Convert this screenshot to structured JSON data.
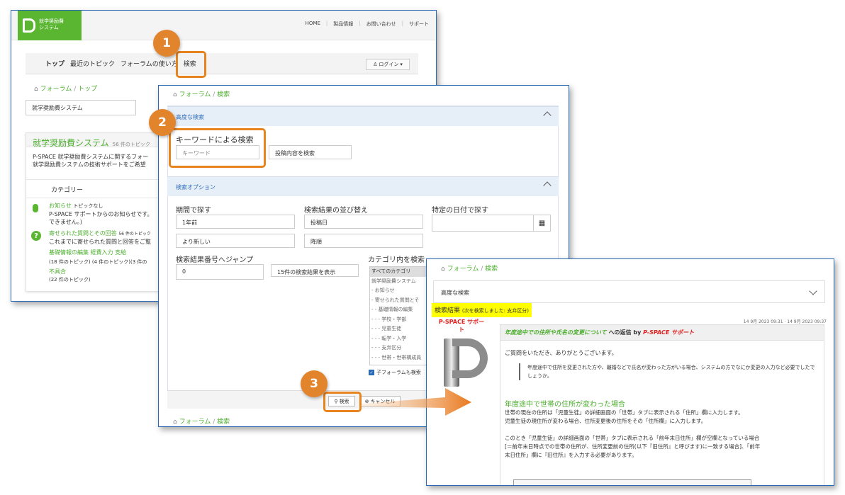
{
  "win1": {
    "logo_text": "就学奨励費\nシステム",
    "topnav": [
      "HOME",
      "製品情報",
      "お問い合わせ",
      "サポート"
    ],
    "menu": [
      "トップ",
      "最近のトピック",
      "フォーラムの使い方",
      "検索"
    ],
    "login": "ログイン",
    "breadcrumb": [
      "フォーラム",
      "トップ"
    ],
    "forum_select": "就学奨励費システム",
    "forum_title": "就学奨励費システム",
    "forum_topics": "56 件のトピック",
    "desc": "P-SPACE 就学奨励費システムに関するフォー\n就学奨励費システムの技術サポートをご希望",
    "category_header": "カテゴリー",
    "cat1_title": "お知らせ",
    "cat1_topics": "トピックなし",
    "cat1_desc": "P-SPACE サポートからのお知らせです。\nできません。)",
    "cat2_title": "寄せられた質問とその回答",
    "cat2_count": "56 件のトピック",
    "cat2_desc": "これまでに寄せられた質問と回答をご覧",
    "sub1": "基礎情報の編集",
    "sub2": "経費入力",
    "sub3": "支給",
    "sub1_count": "(18 件のトピック)",
    "sub2_count": "(4 件のトピック)",
    "sub3_count": "(3 件の",
    "sub4": "不具合",
    "sub4_count": "(22 件のトピック)"
  },
  "win2": {
    "breadcrumb": [
      "フォーラム",
      "検索"
    ],
    "advanced": "高度な検索",
    "keyword_label": "キーワードによる検索",
    "keyword_placeholder": "キーワード",
    "search_in": "投稿内容を検索",
    "options": "検索オプション",
    "period_label": "期間で探す",
    "period_value": "1年前",
    "period_order": "より新しい",
    "sort_label": "検索結果の並び替え",
    "sort_value": "投稿日",
    "sort_dir": "降順",
    "date_label": "特定の日付で探す",
    "jump_label": "検索結果番号へジャンプ",
    "jump_value": "0",
    "show_value": "15件の検索結果を表示",
    "cat_label": "カテゴリ内を検索",
    "cat_items": [
      "すべてのカテゴリ",
      "就学奨励費システム",
      "- お知らせ",
      "- 寄せられた質問とそ",
      "- - 基礎情報の編集",
      "- - - 学校・学部",
      "- - - 児童生徒",
      "- - - 転学・入学",
      "- - - 支弁区分",
      "- - - 世帯・世帯構成員"
    ],
    "child_forum": "子フォーラムも検索",
    "search_btn": "検索",
    "cancel_btn": "キャンセル"
  },
  "win3": {
    "breadcrumb": [
      "フォーラム",
      "検索"
    ],
    "advanced": "高度な検索",
    "result_label": "検索結果",
    "result_note": "(次を検索しました: 支弁区分)",
    "dates": "14 9月 2023 09:31 · 14 9月 2023 09:37",
    "author": "P-SPACE サポート",
    "post_title": "年度途中での住所や氏名の変更について",
    "reply_to": "への返信 by",
    "post_author": "P-SPACE サポート",
    "greeting": "ご質問をいただき、ありがとうございます。",
    "quote": "年度途中で住所を変更された方や、離婚などで氏名が変わった方がいる場合、システムの方でなにか変更の入力など必要でしたでしょうか。",
    "heading": "年度途中で世帯の住所が変わった場合",
    "p1": "世帯の現在の住所は「児童生徒」の詳細画面の「世帯」タブに表示される「住所」欄に入力します。",
    "p2": "児童生徒の現住所が変わる場合、住所変更後の住所をその「住所欄」に入力します。",
    "p3": "このとき「児童生徒」の詳細画面の「世帯」タブに表示される「前年末日住所」欄が空欄となっている場合",
    "p4": "[＝前年末日時点での世帯の住所が、住所変更前の住所(以下『旧住所』と呼びます)に一致する場合]、「前年",
    "p5": "末日住所」欄に『旧住所』を入力する必要があります。"
  },
  "callouts": [
    "1",
    "2",
    "3"
  ]
}
